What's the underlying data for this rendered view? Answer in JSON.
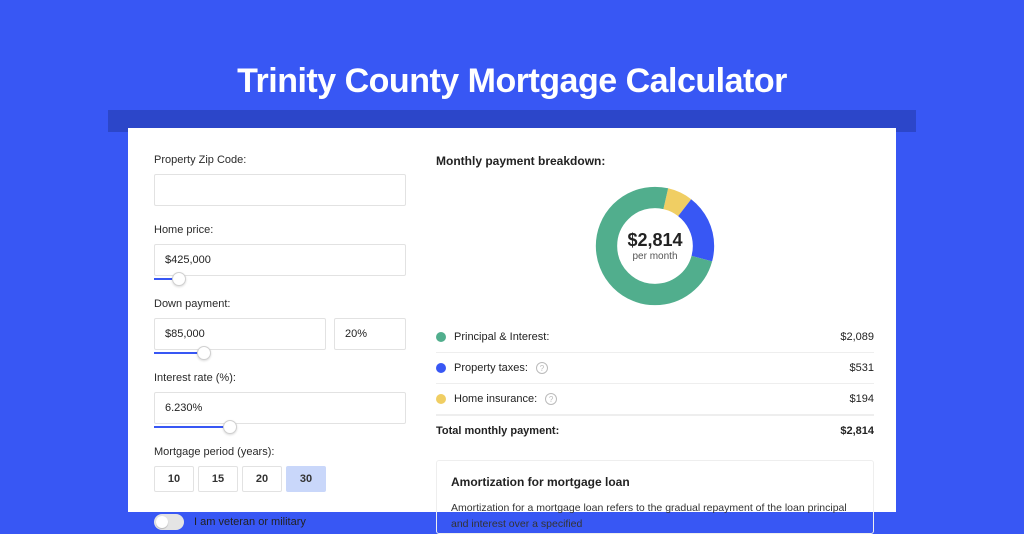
{
  "title": "Trinity County Mortgage Calculator",
  "colors": {
    "green": "#51AE8D",
    "blue": "#3857F4",
    "yellow": "#F0CE63"
  },
  "form": {
    "zip": {
      "label": "Property Zip Code:",
      "value": ""
    },
    "price": {
      "label": "Home price:",
      "value": "$425,000",
      "slider_pct": 10
    },
    "down": {
      "label": "Down payment:",
      "amount": "$85,000",
      "pct": "20%",
      "slider_pct": 20
    },
    "rate": {
      "label": "Interest rate (%):",
      "value": "6.230%",
      "slider_pct": 30
    },
    "period": {
      "label": "Mortgage period (years):",
      "options": [
        "10",
        "15",
        "20",
        "30"
      ],
      "selected": "30"
    },
    "veteran": {
      "label": "I am veteran or military",
      "on": false
    }
  },
  "breakdown": {
    "title": "Monthly payment breakdown:",
    "center_value": "$2,814",
    "center_sub": "per month",
    "items": [
      {
        "key": "pi",
        "label": "Principal & Interest:",
        "value": "$2,089",
        "color": "#51AE8D",
        "has_info": false
      },
      {
        "key": "tax",
        "label": "Property taxes:",
        "value": "$531",
        "color": "#3857F4",
        "has_info": true
      },
      {
        "key": "ins",
        "label": "Home insurance:",
        "value": "$194",
        "color": "#F0CE63",
        "has_info": true
      }
    ],
    "total": {
      "label": "Total monthly payment:",
      "value": "$2,814"
    }
  },
  "chart_data": {
    "type": "pie",
    "title": "Monthly payment breakdown",
    "series": [
      {
        "name": "Principal & Interest",
        "value": 2089,
        "color": "#51AE8D"
      },
      {
        "name": "Property taxes",
        "value": 531,
        "color": "#3857F4"
      },
      {
        "name": "Home insurance",
        "value": 194,
        "color": "#F0CE63"
      }
    ],
    "total_label": "$2,814",
    "total_sub": "per month"
  },
  "amortization": {
    "title": "Amortization for mortgage loan",
    "body": "Amortization for a mortgage loan refers to the gradual repayment of the loan principal and interest over a specified"
  }
}
